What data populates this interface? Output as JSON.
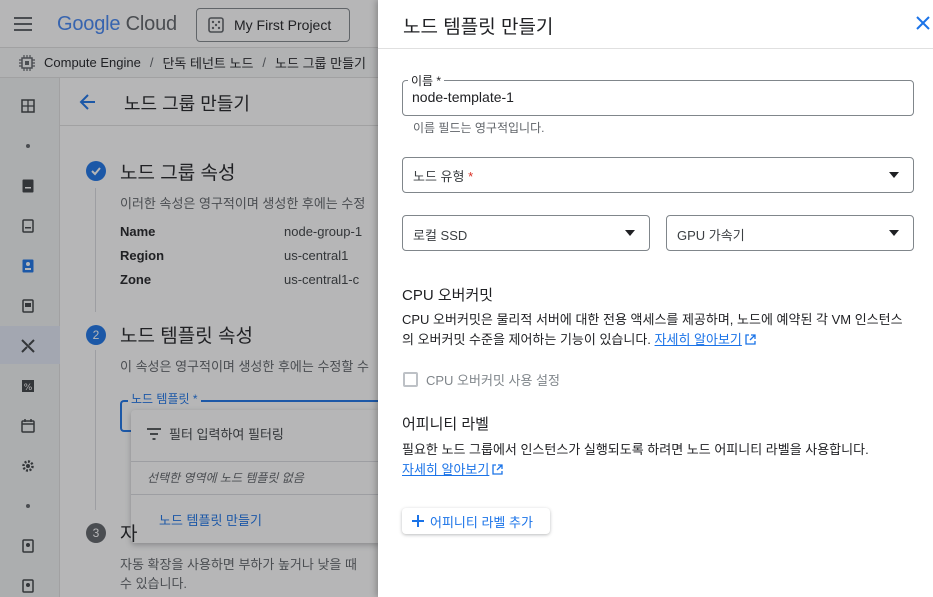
{
  "app": {
    "brand_google": "Google",
    "brand_cloud": "Cloud",
    "project": "My First Project"
  },
  "breadcrumb": {
    "items": [
      "Compute Engine",
      "단독 테넌트 노드",
      "노드 그룹 만들기"
    ]
  },
  "main": {
    "title": "노드 그룹 만들기",
    "step1": {
      "number": "",
      "title": "노드 그룹 속성",
      "desc": "이러한 속성은 영구적이며 생성한 후에는 수정",
      "props": [
        {
          "key": "Name",
          "value": "node-group-1"
        },
        {
          "key": "Region",
          "value": "us-central1"
        },
        {
          "key": "Zone",
          "value": "us-central1-c"
        }
      ]
    },
    "step2": {
      "number": "2",
      "title": "노드 템플릿 속성",
      "desc": "이 속성은 영구적이며 생성한 후에는 수정할 수",
      "field_label": "노드 템플릿 *",
      "dropdown": {
        "filter_placeholder": "필터 입력하여 필터링",
        "empty_text": "선택한 영역에 노드 템플릿 없음",
        "create_link": "노드 템플릿 만들기"
      }
    },
    "step3": {
      "number": "3",
      "title": "자",
      "desc_line1": "자동 확장을 사용하면 부하가 높거나 낮을 때",
      "desc_line2": "수 있습니다."
    }
  },
  "panel": {
    "title": "노드 템플릿 만들기",
    "name_field": {
      "label": "이름 *",
      "value": "node-template-1",
      "helper": "이름 필드는 영구적입니다."
    },
    "node_type_field": {
      "label": "노드 유형",
      "required_mark": "*"
    },
    "local_ssd_field": {
      "label": "로컬 SSD"
    },
    "gpu_field": {
      "label": "GPU 가속기"
    },
    "cpu_overcommit": {
      "title": "CPU 오버커밋",
      "body": "CPU 오버커밋은 물리적 서버에 대한 전용 액세스를 제공하며, 노드에 예약된 각 VM 인스턴스의 오버커밋 수준을 제어하는 기능이 있습니다.",
      "learn_more": "자세히 알아보기",
      "checkbox_label": "CPU 오버커밋 사용 설정",
      "checkbox_checked": false
    },
    "affinity": {
      "title": "어피니티 라벨",
      "body": "필요한 노드 그룹에서 인스턴스가 실행되도록 하려면 노드 어피니티 라벨을 사용합니다.",
      "learn_more": "자세히 알아보기",
      "add_button": "어피니티 라벨 추가"
    }
  },
  "colors": {
    "accent": "#1a73e8",
    "required": "#d93025"
  }
}
